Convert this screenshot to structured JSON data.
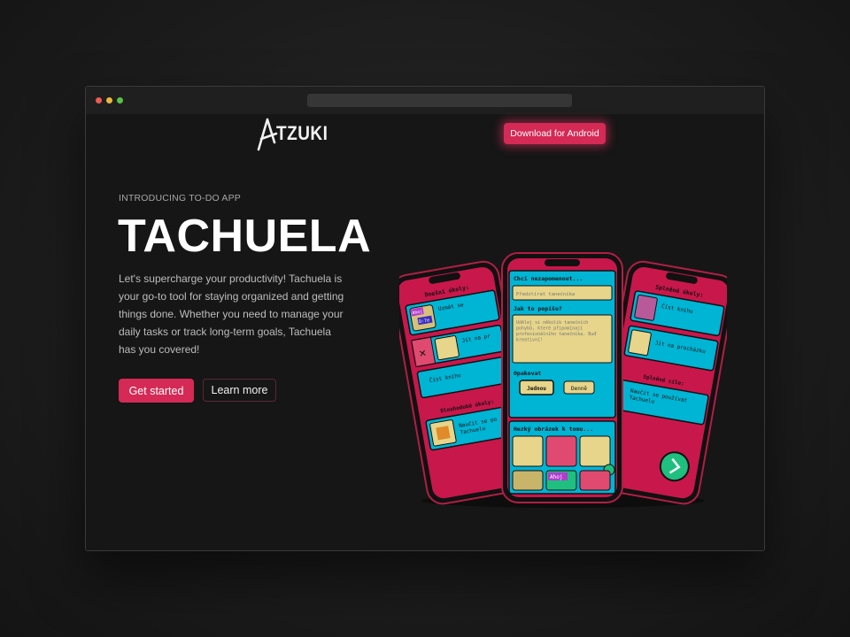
{
  "nav": {
    "logo_text": "TZUKI",
    "download_label": "Download for Android"
  },
  "hero": {
    "eyebrow": "INTRODUCING TO-DO APP",
    "title": "TACHUELA",
    "description": "Let's supercharge your productivity! Tachuela is your go-to tool for staying organized and getting things done. Whether you need to manage your daily tasks or track long-term goals, Tachuela has you covered!",
    "primary_label": "Get started",
    "secondary_label": "Learn more"
  },
  "phone_left": {
    "header": "Dnešní úkoly:",
    "tasks": [
      "Uzmát se",
      "Jít na pr",
      "Číst knihu"
    ],
    "badge_a": "Ahoj",
    "badge_b": "D:7e",
    "section": "Dlouhodobé úkoly:",
    "long_task": "Naučit se po\nTachuelu"
  },
  "phone_center": {
    "q1": "Chci nezapomenout...",
    "input_value": "Předstírat tanečníka",
    "q2": "Jak to popíšu?",
    "text_value": "Udělej si několik tanečních pohybů, které připomínají profesionálního tanečníka. Buď kreativní!",
    "repeat_label": "Opakovat",
    "opt_once": "Jednou",
    "opt_daily": "Denně",
    "image_label": "Hezký obrázek k tomu...",
    "badge": "Ahoj"
  },
  "phone_right": {
    "header": "Splněné úkoly:",
    "tasks": [
      "Číst knihu",
      "Jít na procházku"
    ],
    "section": "Splněné cíle:",
    "goal": "Naučit se používat\nTachuelu"
  },
  "colors": {
    "accent": "#d42a55",
    "phone_cyan": "#00b4d4",
    "phone_crimson": "#c8174b",
    "card_tan": "#e6d58a",
    "fab_green": "#1fbf7f"
  }
}
